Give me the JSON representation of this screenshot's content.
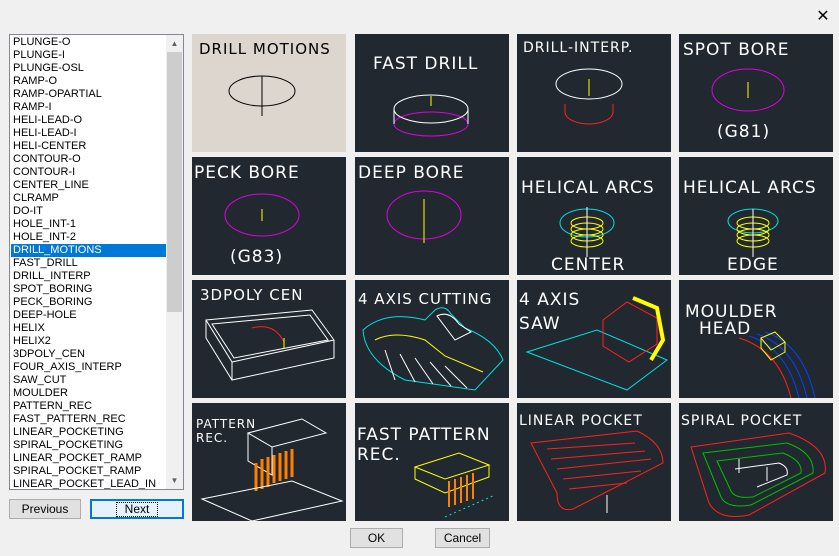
{
  "dialog": {
    "close_label": "✕",
    "list_items": [
      "PLUNGE-O",
      "PLUNGE-I",
      "PLUNGE-OSL",
      "RAMP-O",
      "RAMP-OPARTIAL",
      "RAMP-I",
      "HELI-LEAD-O",
      "HELI-LEAD-I",
      "HELI-CENTER",
      "CONTOUR-O",
      "CONTOUR-I",
      "CENTER_LINE",
      "CLRAMP",
      "DO-IT",
      "HOLE_INT-1",
      "HOLE_INT-2",
      "DRILL_MOTIONS",
      "FAST_DRILL",
      "DRILL_INTERP",
      "SPOT_BORING",
      "PECK_BORING",
      "DEEP-HOLE",
      "HELIX",
      "HELIX2",
      "3DPOLY_CEN",
      "FOUR_AXIS_INTERP",
      "SAW_CUT",
      "MOULDER",
      "PATTERN_REC",
      "FAST_PATTERN_REC",
      "LINEAR_POCKETING",
      "SPIRAL_POCKETING",
      "LINEAR_POCKET_RAMP",
      "SPIRAL_POCKET_RAMP",
      "LINEAR_POCKET_LEAD_IN"
    ],
    "selected_item": "DRILL_MOTIONS",
    "previous_label": "Previous",
    "next_label": "Next",
    "ok_label": "OK",
    "cancel_label": "Cancel"
  },
  "tiles": [
    {
      "id": "drill-motions",
      "lines": [
        "DRILL MOTIONS"
      ],
      "selected": true
    },
    {
      "id": "fast-drill",
      "lines": [
        "FAST DRILL"
      ]
    },
    {
      "id": "drill-interp",
      "lines": [
        "DRILL-INTERP."
      ]
    },
    {
      "id": "spot-bore",
      "lines": [
        "SPOT BORE",
        "(G81)"
      ]
    },
    {
      "id": "peck-bore",
      "lines": [
        "PECK BORE",
        "(G83)"
      ]
    },
    {
      "id": "deep-bore",
      "lines": [
        "DEEP BORE"
      ]
    },
    {
      "id": "helical-arcs-center",
      "lines": [
        "HELICAL ARCS",
        "CENTER"
      ]
    },
    {
      "id": "helical-arcs-edge",
      "lines": [
        "HELICAL ARCS",
        "EDGE"
      ]
    },
    {
      "id": "3dpoly-cen",
      "lines": [
        "3DPOLY CEN"
      ]
    },
    {
      "id": "4axis-cutting",
      "lines": [
        "4 AXIS CUTTING"
      ]
    },
    {
      "id": "4axis-saw",
      "lines": [
        "4 AXIS",
        "SAW"
      ]
    },
    {
      "id": "moulder-head",
      "lines": [
        "MOULDER",
        "HEAD"
      ]
    },
    {
      "id": "pattern-rec",
      "lines": [
        "PATTERN",
        "REC."
      ]
    },
    {
      "id": "fast-pattern-rec",
      "lines": [
        "FAST PATTERN",
        "REC."
      ]
    },
    {
      "id": "linear-pocket",
      "lines": [
        "LINEAR POCKET"
      ]
    },
    {
      "id": "spiral-pocket",
      "lines": [
        "SPIRAL POCKET"
      ]
    }
  ],
  "colors": {
    "tile_bg": "#212830",
    "tile_selected_bg": "#dcd6cf",
    "list_selection": "#0078d7",
    "accent_magenta": "#e000e0",
    "accent_yellow": "#ffff00",
    "accent_red": "#ff2020",
    "accent_cyan": "#00e0e0",
    "accent_orange": "#ff7f00"
  }
}
